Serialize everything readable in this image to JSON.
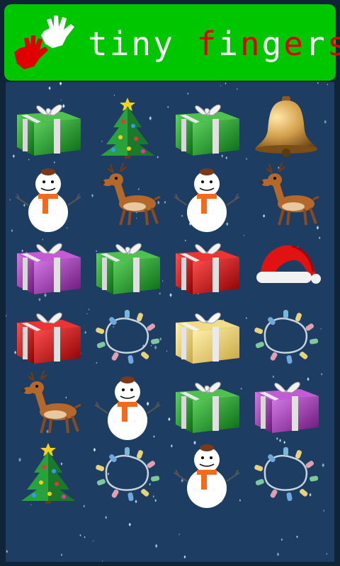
{
  "app": {
    "title_parts": [
      {
        "text": "tiny ",
        "color": "white"
      },
      {
        "text": "f",
        "color": "red"
      },
      {
        "text": "i",
        "color": "white"
      },
      {
        "text": "n",
        "color": "red"
      },
      {
        "text": "g",
        "color": "white"
      },
      {
        "text": "e",
        "color": "red"
      },
      {
        "text": "r",
        "color": "white"
      },
      {
        "text": "s",
        "color": "red"
      }
    ],
    "header_color": "#00c600",
    "board_color": "#1d3d63"
  },
  "board": {
    "columns": 4,
    "rows": 6,
    "tiles": [
      [
        "gift-green",
        "christmas-tree",
        "gift-green",
        "bell"
      ],
      [
        "snowman",
        "reindeer",
        "snowman",
        "reindeer"
      ],
      [
        "gift-purple",
        "gift-green",
        "gift-red",
        "santa-hat"
      ],
      [
        "gift-red",
        "lights",
        "gift-gold",
        "lights"
      ],
      [
        "reindeer",
        "snowman",
        "gift-green",
        "gift-purple"
      ],
      [
        "christmas-tree",
        "lights",
        "snowman",
        "lights"
      ]
    ]
  }
}
